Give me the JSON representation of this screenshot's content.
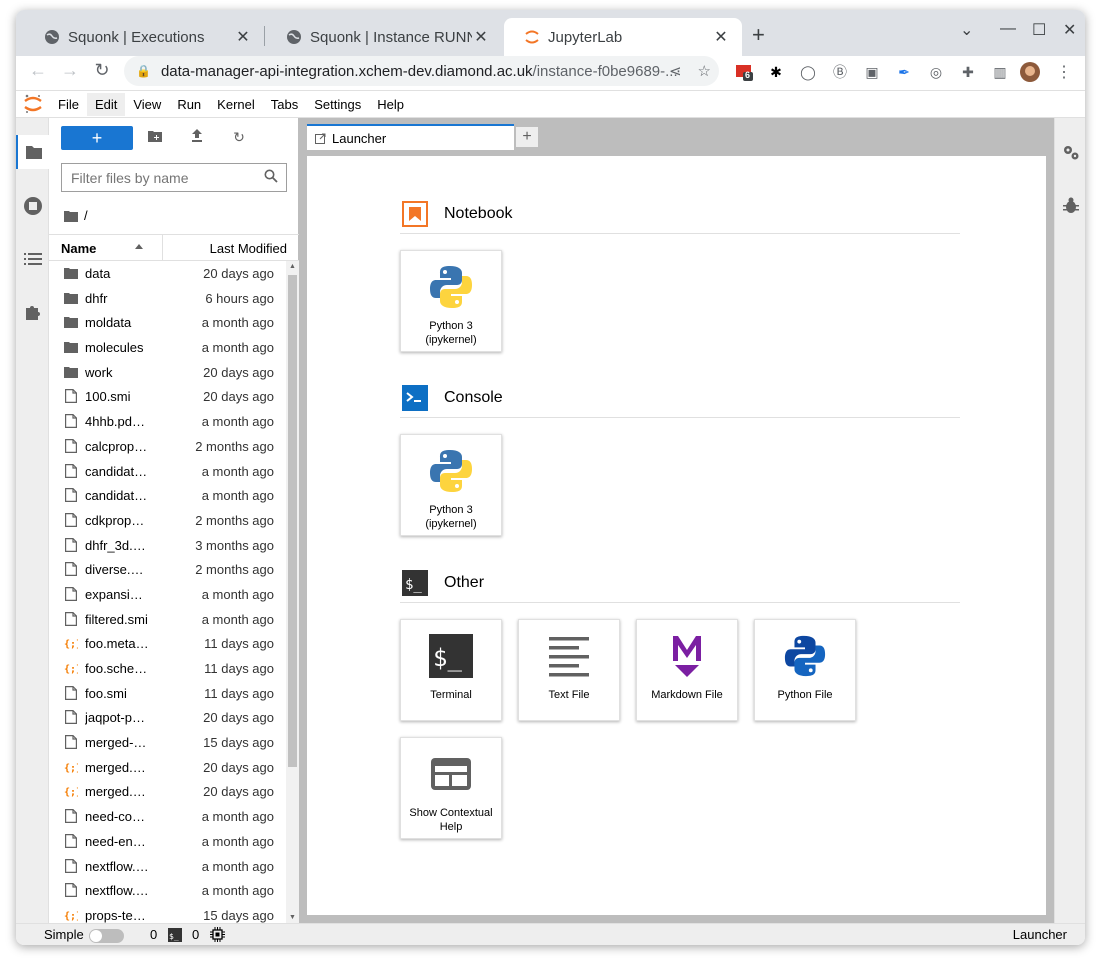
{
  "browser": {
    "tabs": [
      {
        "title": "Squonk | Executions",
        "favicon": "globe-icon"
      },
      {
        "title": "Squonk | Instance RUNNING",
        "favicon": "globe-icon"
      },
      {
        "title": "JupyterLab",
        "favicon": "jupyter-icon",
        "active": true
      }
    ],
    "address": {
      "host": "data-manager-api-integration.xchem-dev.diamond.ac.uk",
      "path": "/instance-f0be9689-..."
    },
    "extension_badge": "6"
  },
  "menu": {
    "items": [
      "File",
      "Edit",
      "View",
      "Run",
      "Kernel",
      "Tabs",
      "Settings",
      "Help"
    ],
    "active": "Edit"
  },
  "filebrowser": {
    "filter_placeholder": "Filter files by name",
    "breadcrumb": "/",
    "col_name": "Name",
    "col_modified": "Last Modified",
    "files": [
      {
        "name": "data",
        "type": "folder",
        "modified": "20 days ago"
      },
      {
        "name": "dhfr",
        "type": "folder",
        "modified": "6 hours ago"
      },
      {
        "name": "moldata",
        "type": "folder",
        "modified": "a month ago"
      },
      {
        "name": "molecules",
        "type": "folder",
        "modified": "a month ago"
      },
      {
        "name": "work",
        "type": "folder",
        "modified": "20 days ago"
      },
      {
        "name": "100.smi",
        "type": "file",
        "modified": "20 days ago"
      },
      {
        "name": "4hhb.pd…",
        "type": "file",
        "modified": "a month ago"
      },
      {
        "name": "calcprop…",
        "type": "file",
        "modified": "2 months ago"
      },
      {
        "name": "candidat…",
        "type": "file",
        "modified": "a month ago"
      },
      {
        "name": "candidat…",
        "type": "file",
        "modified": "a month ago"
      },
      {
        "name": "cdkprop…",
        "type": "file",
        "modified": "2 months ago"
      },
      {
        "name": "dhfr_3d.…",
        "type": "file",
        "modified": "3 months ago"
      },
      {
        "name": "diverse.…",
        "type": "file",
        "modified": "2 months ago"
      },
      {
        "name": "expansi…",
        "type": "file",
        "modified": "a month ago"
      },
      {
        "name": "filtered.smi",
        "type": "file",
        "modified": "a month ago"
      },
      {
        "name": "foo.meta…",
        "type": "json",
        "modified": "11 days ago"
      },
      {
        "name": "foo.sche…",
        "type": "json",
        "modified": "11 days ago"
      },
      {
        "name": "foo.smi",
        "type": "file",
        "modified": "11 days ago"
      },
      {
        "name": "jaqpot-p…",
        "type": "file",
        "modified": "20 days ago"
      },
      {
        "name": "merged-…",
        "type": "file",
        "modified": "15 days ago"
      },
      {
        "name": "merged.…",
        "type": "json",
        "modified": "20 days ago"
      },
      {
        "name": "merged.…",
        "type": "json",
        "modified": "20 days ago"
      },
      {
        "name": "need-co…",
        "type": "file",
        "modified": "a month ago"
      },
      {
        "name": "need-en…",
        "type": "file",
        "modified": "a month ago"
      },
      {
        "name": "nextflow.…",
        "type": "file",
        "modified": "a month ago"
      },
      {
        "name": "nextflow.…",
        "type": "file",
        "modified": "a month ago"
      },
      {
        "name": "props-te…",
        "type": "json",
        "modified": "15 days ago"
      }
    ]
  },
  "dock": {
    "tab_title": "Launcher"
  },
  "launcher": {
    "notebook": {
      "title": "Notebook",
      "cards": [
        {
          "label": "Python 3 (ipykernel)"
        }
      ]
    },
    "console": {
      "title": "Console",
      "cards": [
        {
          "label": "Python 3 (ipykernel)"
        }
      ]
    },
    "other": {
      "title": "Other",
      "cards": [
        {
          "label": "Terminal",
          "icon": "terminal-icon"
        },
        {
          "label": "Text File",
          "icon": "text-file-icon"
        },
        {
          "label": "Markdown File",
          "icon": "markdown-icon"
        },
        {
          "label": "Python File",
          "icon": "python-file-icon"
        },
        {
          "label": "Show Contextual Help",
          "icon": "contextual-help-icon"
        }
      ]
    }
  },
  "status": {
    "simple_label": "Simple",
    "kernels_count": "0",
    "terminals_count": "0",
    "mode": "Launcher"
  },
  "colors": {
    "accent": "#1976d2",
    "jupyter_orange": "#f37626",
    "markdown_purple": "#7b1fa2"
  }
}
